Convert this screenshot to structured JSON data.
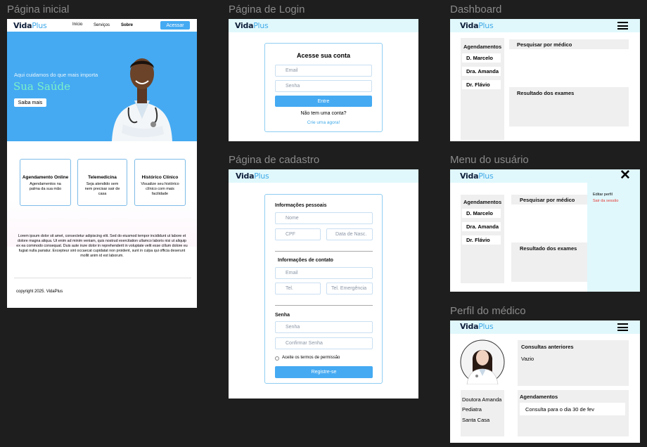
{
  "frames": {
    "home": "Página inicial",
    "login": "Página de Login",
    "dashboard": "Dashboard",
    "signup": "Página de cadastro",
    "user_menu": "Menu do usuário",
    "doctor": "Perfil do médico"
  },
  "brand": {
    "part1": "Vida",
    "part2": "Plus"
  },
  "home": {
    "nav": [
      "Início",
      "Serviços",
      "Sobre"
    ],
    "cta": "Acessar",
    "hero_sub": "Aqui cuidamos do que mais importa",
    "hero_title": "Sua Saúde",
    "hero_button": "Saiba mais",
    "cards": [
      {
        "title": "Agendamento Online",
        "text": "Agendamentos na palma da sua mão"
      },
      {
        "title": "Telemedicina",
        "text": "Seja atendido sem nem precisar sair de casa"
      },
      {
        "title": "Histórico Clínico",
        "text": "Visualize seu histórico clínico com mais facilidade"
      }
    ],
    "lorem": "Lorem ipsum dolor sit amet, consectetur adipiscing elit. Sed do eiusmod tempor incididunt ut labore et dolore magna aliqua. Ut enim ad minim veniam, quis nostrud exercitation ullamco laboris nisi ut aliquip ex ea commodo consequat. Duis aute irure dolor in reprehenderit in voluptate velit esse cillum dolore eu fugiat nulla pariatur. Excepteur sint occaecat cupidatat non proident, sunt in culpa qui officia deserunt mollit anim id est laborum.",
    "footer": "copyright 2025. VidaPlus"
  },
  "login": {
    "heading": "Acesse sua conta",
    "email_placeholder": "Email",
    "password_placeholder": "Senha",
    "submit": "Entre",
    "no_account": "Não tem uma conta?",
    "create_link": "Crie uma agora!"
  },
  "signup": {
    "section_personal": "Informações pessoais",
    "name": "Nome",
    "cpf": "CPF",
    "birth": "Data de Nasc.",
    "section_contact": "Informações de contato",
    "email": "Email",
    "phone": "Tel.",
    "emergency": "Tel. Emergência",
    "section_password": "Senha",
    "password": "Senha",
    "confirm": "Confirmar Senha",
    "terms": "Aceite os termos de permissão",
    "submit": "Registre-se"
  },
  "dashboard": {
    "appointments": "Agendamentos",
    "doctors": [
      "D. Marcelo",
      "Dra. Amanda",
      "Dr. Flávio"
    ],
    "search": "Pesquisar por médico",
    "results": "Resultado dos exames"
  },
  "user_menu": {
    "appointments": "Agendamentos",
    "doctors": [
      "D. Marcelo",
      "Dra. Amanda",
      "Dr. Flávio"
    ],
    "search": "Pesquisar por médico",
    "results": "Resultado dos exames",
    "edit_profile": "Editar perfil",
    "logout": "Sair da sessão",
    "close": "✕"
  },
  "doctor": {
    "info": [
      "Doutora Amanda",
      "Pediatra",
      "Santa Casa"
    ],
    "past_title": "Consultas anteriores",
    "past_value": "Vazio",
    "appointments_title": "Agendamentos",
    "appointment_item": "Consulta para o dia 30 de fev"
  },
  "colors": {
    "accent": "#45aaf2",
    "topbar": "#e0f8fc",
    "hero": "#45aaf2",
    "logout": "#e53935"
  }
}
